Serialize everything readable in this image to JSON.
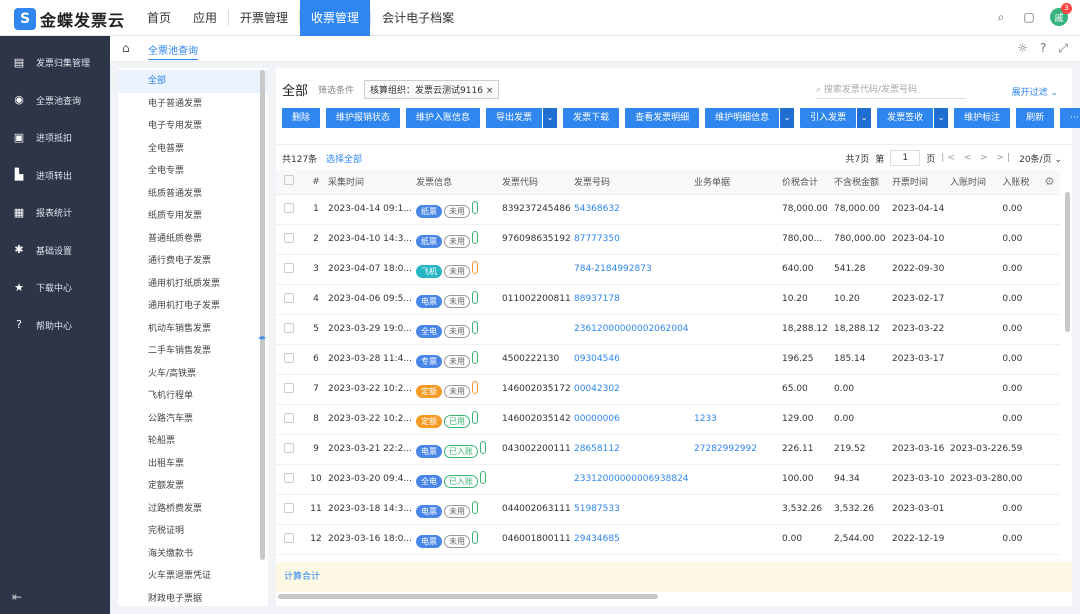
{
  "logo": {
    "mark": "S",
    "text": "金蝶发票云"
  },
  "nav": [
    "首页",
    "应用",
    "开票管理",
    "收票管理",
    "会计电子档案"
  ],
  "nav_active": 3,
  "top": {
    "avatar": "戚",
    "badge": "3"
  },
  "sidebar": [
    {
      "icon": "inbox-icon",
      "glyph": "▤",
      "label": "发票归集管理"
    },
    {
      "icon": "pool-icon",
      "glyph": "◉",
      "label": "全票池查询"
    },
    {
      "icon": "input-tax-icon",
      "glyph": "▣",
      "label": "进项抵扣"
    },
    {
      "icon": "output-icon",
      "glyph": "▙",
      "label": "进项转出"
    },
    {
      "icon": "report-icon",
      "glyph": "▦",
      "label": "报表统计"
    },
    {
      "icon": "gear-icon",
      "glyph": "✱",
      "label": "基础设置"
    },
    {
      "icon": "star-icon",
      "glyph": "★",
      "label": "下载中心"
    },
    {
      "icon": "help-icon",
      "glyph": "?",
      "label": "帮助中心"
    }
  ],
  "sidebar_bottom": "⇤",
  "breadcrumb": "全票池查询",
  "tree": [
    "全部",
    "电子普通发票",
    "电子专用发票",
    "全电普票",
    "全电专票",
    "纸质普通发票",
    "纸质专用发票",
    "普通纸质卷票",
    "通行费电子发票",
    "通用机打纸质发票",
    "通用机打电子发票",
    "机动车销售发票",
    "二手车销售发票",
    "火车/高铁票",
    "飞机行程单",
    "公路汽车票",
    "轮船票",
    "出租车票",
    "定额发票",
    "过路桥费发票",
    "完税证明",
    "海关缴款书",
    "火车票退票凭证",
    "财政电子票据"
  ],
  "main": {
    "title": "全部",
    "filter_label": "筛选条件",
    "filter_tag": "核算组织：发票云测试9116",
    "filter_close": "×",
    "search_placeholder": "搜索发票代码/发票号码",
    "expand": "展开过滤"
  },
  "toolbar": [
    {
      "label": "删除",
      "split": false
    },
    {
      "label": "维护报销状态",
      "split": false
    },
    {
      "label": "维护入账信息",
      "split": false
    },
    {
      "label": "导出发票",
      "split": true
    },
    {
      "label": "发票下载",
      "split": false
    },
    {
      "label": "查看发票明细",
      "split": false
    },
    {
      "label": "维护明细信息",
      "split": true
    },
    {
      "label": "引入发票",
      "split": true
    },
    {
      "label": "发票签收",
      "split": true
    },
    {
      "label": "维护标注",
      "split": false
    },
    {
      "label": "刷新",
      "split": false
    },
    {
      "label": "···",
      "split": false
    }
  ],
  "table_top": {
    "count": "共127条",
    "select_all": "选择全部",
    "pages": "共7页",
    "page_label": "第",
    "page": "1",
    "page_unit": "页",
    "nav": "|< < > >|",
    "per_page": "20条/页"
  },
  "columns": [
    "#",
    "采集时间",
    "发票信息",
    "发票代码",
    "发票号码",
    "业务单据",
    "价税合计",
    "不含税金额",
    "开票时间",
    "入账时间",
    "入账税"
  ],
  "rows": [
    {
      "n": "1",
      "time": "2023-04-14 09:1...",
      "tags": [
        [
          "纸票",
          "t-blue"
        ],
        [
          "未用",
          "used"
        ],
        [
          "",
          "mini"
        ]
      ],
      "code": "839237245486",
      "no": "54368632",
      "biz": "",
      "total": "78,000.00",
      "net": "78,000.00",
      "issue": "2023-04-14",
      "entry": "",
      "tax": "0.00"
    },
    {
      "n": "2",
      "time": "2023-04-10 14:3...",
      "tags": [
        [
          "纸票",
          "t-blue"
        ],
        [
          "未用",
          "used"
        ],
        [
          "",
          "mini"
        ]
      ],
      "code": "976098635192",
      "no": "87777350",
      "biz": "",
      "total": "780,00...",
      "net": "780,000.00",
      "issue": "2023-04-10",
      "entry": "",
      "tax": "0.00"
    },
    {
      "n": "3",
      "time": "2023-04-07 18:0...",
      "tags": [
        [
          "飞机",
          "t-teal"
        ],
        [
          "未用",
          "used"
        ],
        [
          "",
          "mini-o"
        ]
      ],
      "code": "",
      "no": "784-2184992873",
      "biz": "",
      "total": "640.00",
      "net": "541.28",
      "issue": "2022-09-30",
      "entry": "",
      "tax": "0.00"
    },
    {
      "n": "4",
      "time": "2023-04-06 09:5...",
      "tags": [
        [
          "电票",
          "t-blue"
        ],
        [
          "未用",
          "used"
        ],
        [
          "",
          "mini"
        ]
      ],
      "code": "011002200811",
      "no": "88937178",
      "biz": "",
      "total": "10.20",
      "net": "10.20",
      "issue": "2023-02-17",
      "entry": "",
      "tax": "0.00"
    },
    {
      "n": "5",
      "time": "2023-03-29 19:0...",
      "tags": [
        [
          "全电",
          "t-blue"
        ],
        [
          "未用",
          "used"
        ],
        [
          "",
          "mini"
        ]
      ],
      "code": "",
      "no": "23612000000002062004",
      "biz": "",
      "total": "18,288.12",
      "net": "18,288.12",
      "issue": "2023-03-22",
      "entry": "",
      "tax": "0.00"
    },
    {
      "n": "6",
      "time": "2023-03-28 11:4...",
      "tags": [
        [
          "专票",
          "t-blue"
        ],
        [
          "未用",
          "used"
        ],
        [
          "",
          "mini"
        ]
      ],
      "code": "4500222130",
      "no": "09304546",
      "biz": "",
      "total": "196.25",
      "net": "185.14",
      "issue": "2023-03-17",
      "entry": "",
      "tax": "0.00"
    },
    {
      "n": "7",
      "time": "2023-03-22 10:2...",
      "tags": [
        [
          "定额",
          "t-orange"
        ],
        [
          "未用",
          "used"
        ],
        [
          "",
          "mini-o"
        ]
      ],
      "code": "146002035172",
      "no": "00042302",
      "biz": "",
      "total": "65.00",
      "net": "0.00",
      "issue": "",
      "entry": "",
      "tax": "0.00"
    },
    {
      "n": "8",
      "time": "2023-03-22 10:2...",
      "tags": [
        [
          "定额",
          "t-orange"
        ],
        [
          "已用",
          "green"
        ],
        [
          "",
          "mini"
        ]
      ],
      "code": "146002035142",
      "no": "00000006",
      "biz": "1233",
      "total": "129.00",
      "net": "0.00",
      "issue": "",
      "entry": "",
      "tax": "0.00"
    },
    {
      "n": "9",
      "time": "2023-03-21 22:2...",
      "tags": [
        [
          "电票",
          "t-blue"
        ],
        [
          "已入账",
          "green"
        ],
        [
          "",
          "mini"
        ]
      ],
      "code": "043002200111",
      "no": "28658112",
      "biz": "27282992992",
      "total": "226.11",
      "net": "219.52",
      "issue": "2023-03-16",
      "entry": "2023-03-22",
      "tax": "6.59"
    },
    {
      "n": "10",
      "time": "2023-03-20 09:4...",
      "tags": [
        [
          "全电",
          "t-blue"
        ],
        [
          "已入账",
          "green"
        ],
        [
          "",
          "mini"
        ]
      ],
      "code": "",
      "no": "23312000000006938824",
      "biz": "",
      "total": "100.00",
      "net": "94.34",
      "issue": "2023-03-10",
      "entry": "2023-03-28",
      "tax": "0.00"
    },
    {
      "n": "11",
      "time": "2023-03-18 14:3...",
      "tags": [
        [
          "电票",
          "t-blue"
        ],
        [
          "未用",
          "used"
        ],
        [
          "",
          "mini"
        ]
      ],
      "code": "044002063111",
      "no": "51987533",
      "biz": "",
      "total": "3,532.26",
      "net": "3,532.26",
      "issue": "2023-03-01",
      "entry": "",
      "tax": "0.00"
    },
    {
      "n": "12",
      "time": "2023-03-16 18:0...",
      "tags": [
        [
          "电票",
          "t-blue"
        ],
        [
          "未用",
          "used"
        ],
        [
          "",
          "mini"
        ]
      ],
      "code": "046001800111",
      "no": "29434685",
      "biz": "",
      "total": "0.00",
      "net": "2,544.00",
      "issue": "2022-12-19",
      "entry": "",
      "tax": "0.00"
    }
  ],
  "footer": "计算合计"
}
